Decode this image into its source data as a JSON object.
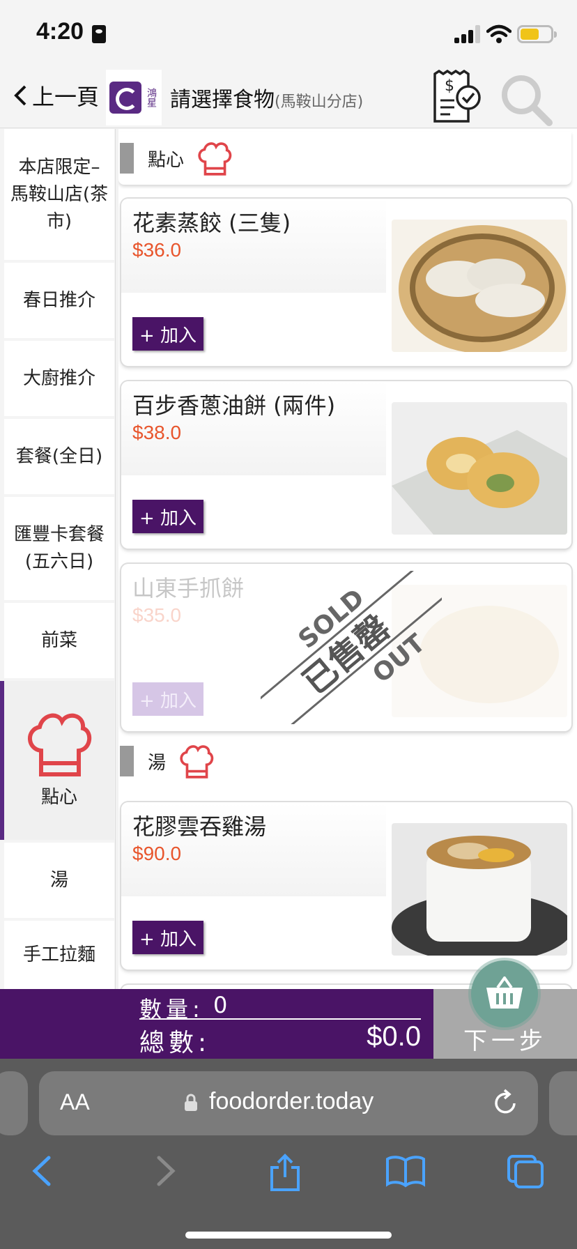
{
  "status": {
    "time": "4:20"
  },
  "header": {
    "back_label": "上一頁",
    "title": "請選擇食物",
    "subtitle": "(馬鞍山分店)",
    "logo_text": "鴻星"
  },
  "sidebar": {
    "items": [
      {
        "label": "本店限定–馬鞍山店(茶市)"
      },
      {
        "label": "春日推介"
      },
      {
        "label": "大廚推介"
      },
      {
        "label": "套餐(全日)"
      },
      {
        "label": "匯豐卡套餐(五六日)"
      },
      {
        "label": "前菜"
      },
      {
        "label": "點心"
      },
      {
        "label": "湯"
      },
      {
        "label": "手工拉麵"
      }
    ]
  },
  "sections": [
    {
      "title": "點心"
    },
    {
      "title": "湯"
    }
  ],
  "items": [
    {
      "name": "花素蒸餃 (三隻)",
      "price": "$36.0",
      "add_label": "+ 加入",
      "sold_out": false
    },
    {
      "name": "百步香蔥油餅 (兩件)",
      "price": "$38.0",
      "add_label": "+ 加入",
      "sold_out": false
    },
    {
      "name": "山東手抓餅",
      "price": "$35.0",
      "add_label": "+ 加入",
      "sold_out": true,
      "stamp_top": "SOLD",
      "stamp_mid": "已售罄",
      "stamp_bot": "OUT"
    },
    {
      "name": "花膠雲吞雞湯",
      "price": "$90.0",
      "add_label": "+ 加入",
      "sold_out": false
    }
  ],
  "cart": {
    "qty_label": "數量:",
    "qty_value": "0",
    "total_label": "總數:",
    "total_value": "$0.0",
    "next_label": "下一步"
  },
  "browser": {
    "aa_label": "AA",
    "url": "foodorder.today"
  },
  "colors": {
    "brand": "#4a1466",
    "price": "#e8552c",
    "chef": "#e0454a"
  }
}
